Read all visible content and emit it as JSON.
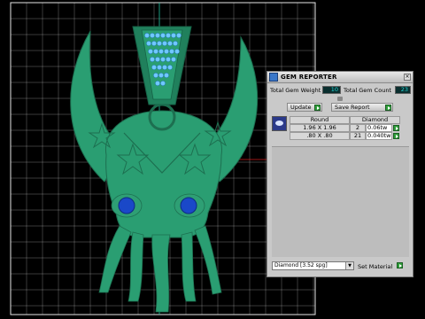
{
  "panel": {
    "title": "GEM REPORTER",
    "close_glyph": "×",
    "app_icon": "gem-reporter-icon",
    "total_gem_weight_label": "Total Gem Weight",
    "total_gem_weight_value": "10",
    "total_gem_count_label": "Total Gem Count",
    "total_gem_count_value": "23",
    "update_label": "Update",
    "save_report_label": "Save Report",
    "table": {
      "columns": [
        "Round",
        "Diamond"
      ],
      "rows": [
        {
          "size": "1.96 X 1.96",
          "count": "2",
          "weight": "0.06tw"
        },
        {
          "size": ".80 X .80",
          "count": "21",
          "weight": "0.040tw"
        }
      ]
    },
    "material_select": "Diamond   [3.52 spg]",
    "set_material_label": "Set Material"
  },
  "colors": {
    "model_green": "#2a9e72",
    "gem_blue": "#1a48c8",
    "grid_line": "#d9d9d9",
    "axis_red": "#d21e1e",
    "field_text": "#22d3d3"
  }
}
